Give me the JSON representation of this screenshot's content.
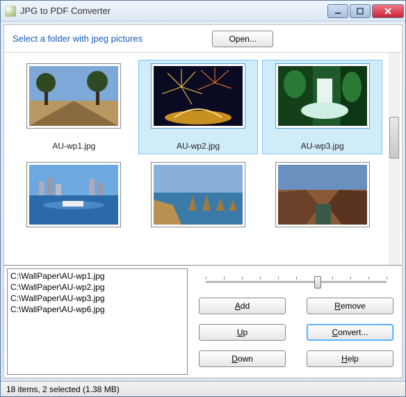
{
  "window": {
    "title": "JPG to PDF Converter"
  },
  "toolbar": {
    "prompt": "Select a folder with jpeg pictures",
    "open_label": "Open..."
  },
  "thumbnails": [
    {
      "name": "AU-wp1.jpg",
      "selected": false
    },
    {
      "name": "AU-wp2.jpg",
      "selected": true
    },
    {
      "name": "AU-wp3.jpg",
      "selected": true
    },
    {
      "name": "",
      "selected": false
    },
    {
      "name": "",
      "selected": false
    },
    {
      "name": "",
      "selected": false
    }
  ],
  "filelist": [
    "C:\\WallPaper\\AU-wp1.jpg",
    "C:\\WallPaper\\AU-wp2.jpg",
    "C:\\WallPaper\\AU-wp3.jpg",
    "C:\\WallPaper\\AU-wp6.jpg"
  ],
  "buttons": {
    "add": "Add",
    "remove": "Remove",
    "up": "Up",
    "convert": "Convert...",
    "down": "Down",
    "help": "Help"
  },
  "status": "18 items, 2 selected (1.38 MB)"
}
